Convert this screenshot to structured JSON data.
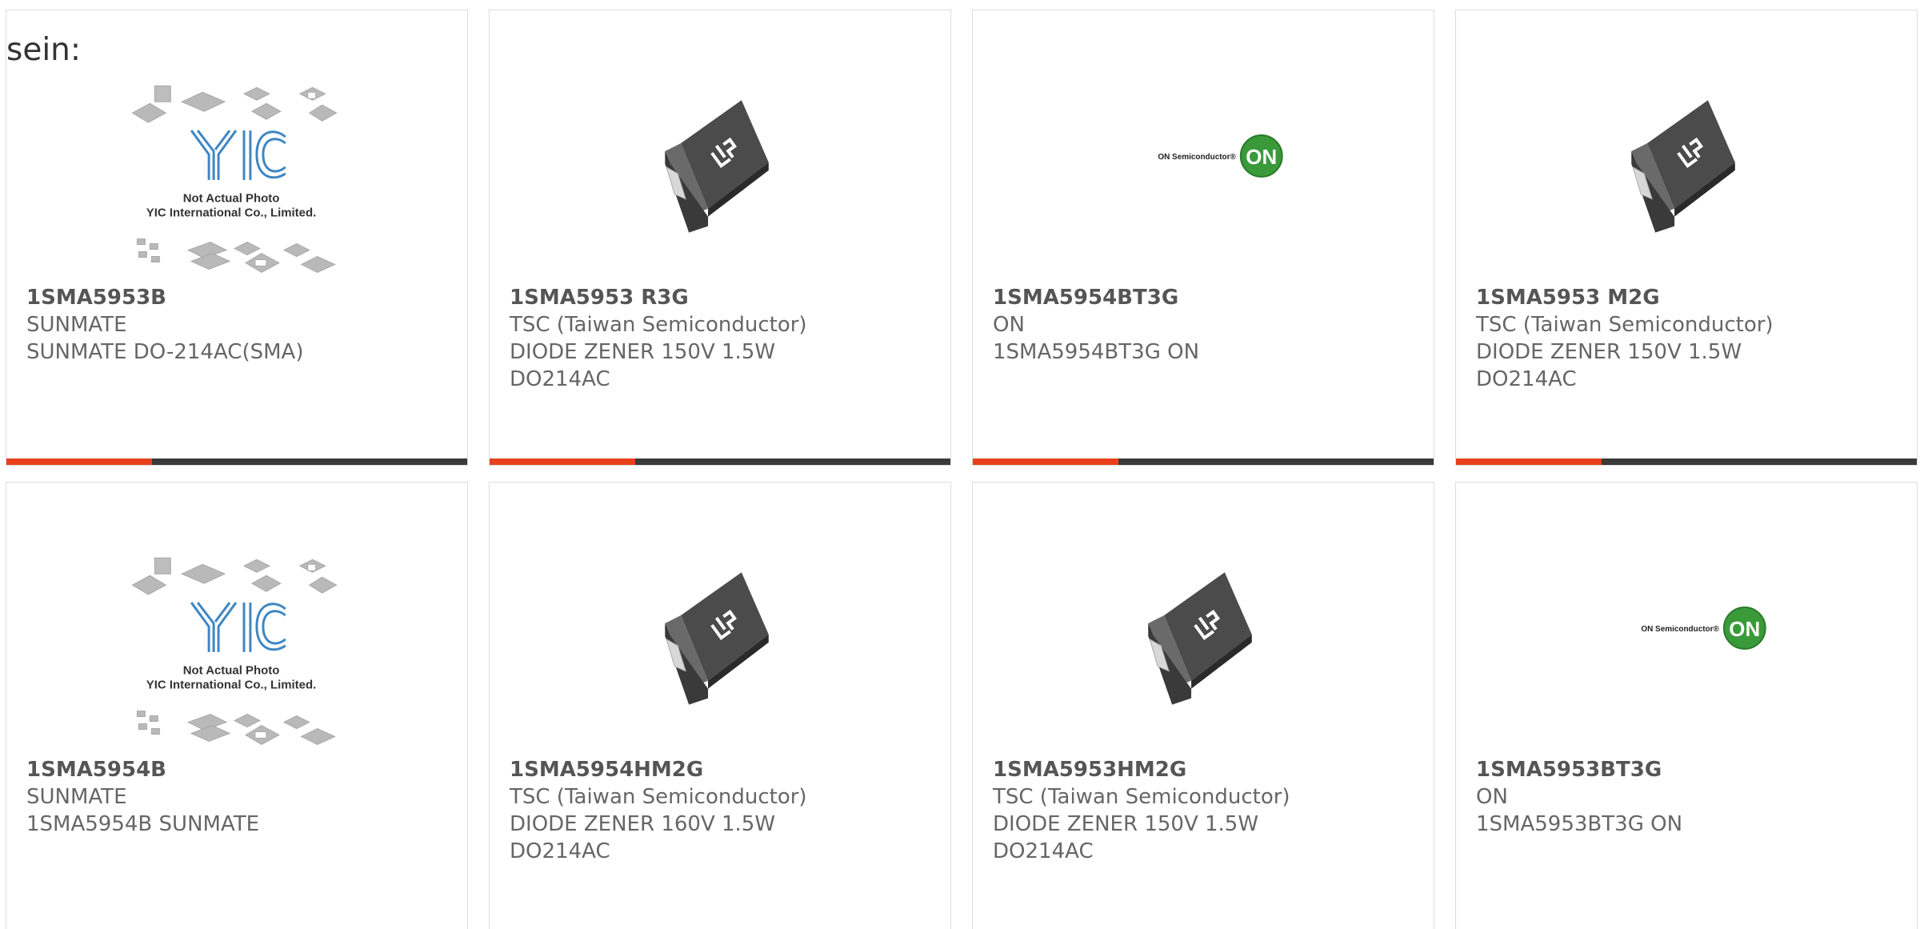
{
  "intro_text": "sein:",
  "placeholder": {
    "line1": "Not Actual Photo",
    "line2": "YIC International Co., Limited.",
    "logo": "YIC"
  },
  "on_logo": {
    "wordmark": "ON Semiconductor",
    "badge": "ON",
    "badge_color": "#3a9a3a"
  },
  "accent_color": "#e8401c",
  "products": [
    {
      "part": "1SMA5953B",
      "manufacturer": "SUNMATE",
      "desc1": "SUNMATE DO-214AC(SMA)",
      "desc2": "",
      "image": "yic-placeholder"
    },
    {
      "part": "1SMA5953 R3G",
      "manufacturer": "TSC (Taiwan Semiconductor)",
      "desc1": "DIODE ZENER 150V 1.5W",
      "desc2": "DO214AC",
      "image": "sma-package"
    },
    {
      "part": "1SMA5954BT3G",
      "manufacturer": "ON",
      "desc1": "1SMA5954BT3G ON",
      "desc2": "",
      "image": "on-semiconductor-logo"
    },
    {
      "part": "1SMA5953 M2G",
      "manufacturer": "TSC (Taiwan Semiconductor)",
      "desc1": "DIODE ZENER 150V 1.5W",
      "desc2": "DO214AC",
      "image": "sma-package"
    },
    {
      "part": "1SMA5954B",
      "manufacturer": "SUNMATE",
      "desc1": "1SMA5954B SUNMATE",
      "desc2": "",
      "image": "yic-placeholder"
    },
    {
      "part": "1SMA5954HM2G",
      "manufacturer": "TSC (Taiwan Semiconductor)",
      "desc1": "DIODE ZENER 160V 1.5W",
      "desc2": "DO214AC",
      "image": "sma-package"
    },
    {
      "part": "1SMA5953HM2G",
      "manufacturer": "TSC (Taiwan Semiconductor)",
      "desc1": "DIODE ZENER 150V 1.5W",
      "desc2": "DO214AC",
      "image": "sma-package"
    },
    {
      "part": "1SMA5953BT3G",
      "manufacturer": "ON",
      "desc1": "1SMA5953BT3G ON",
      "desc2": "",
      "image": "on-semiconductor-logo"
    }
  ]
}
